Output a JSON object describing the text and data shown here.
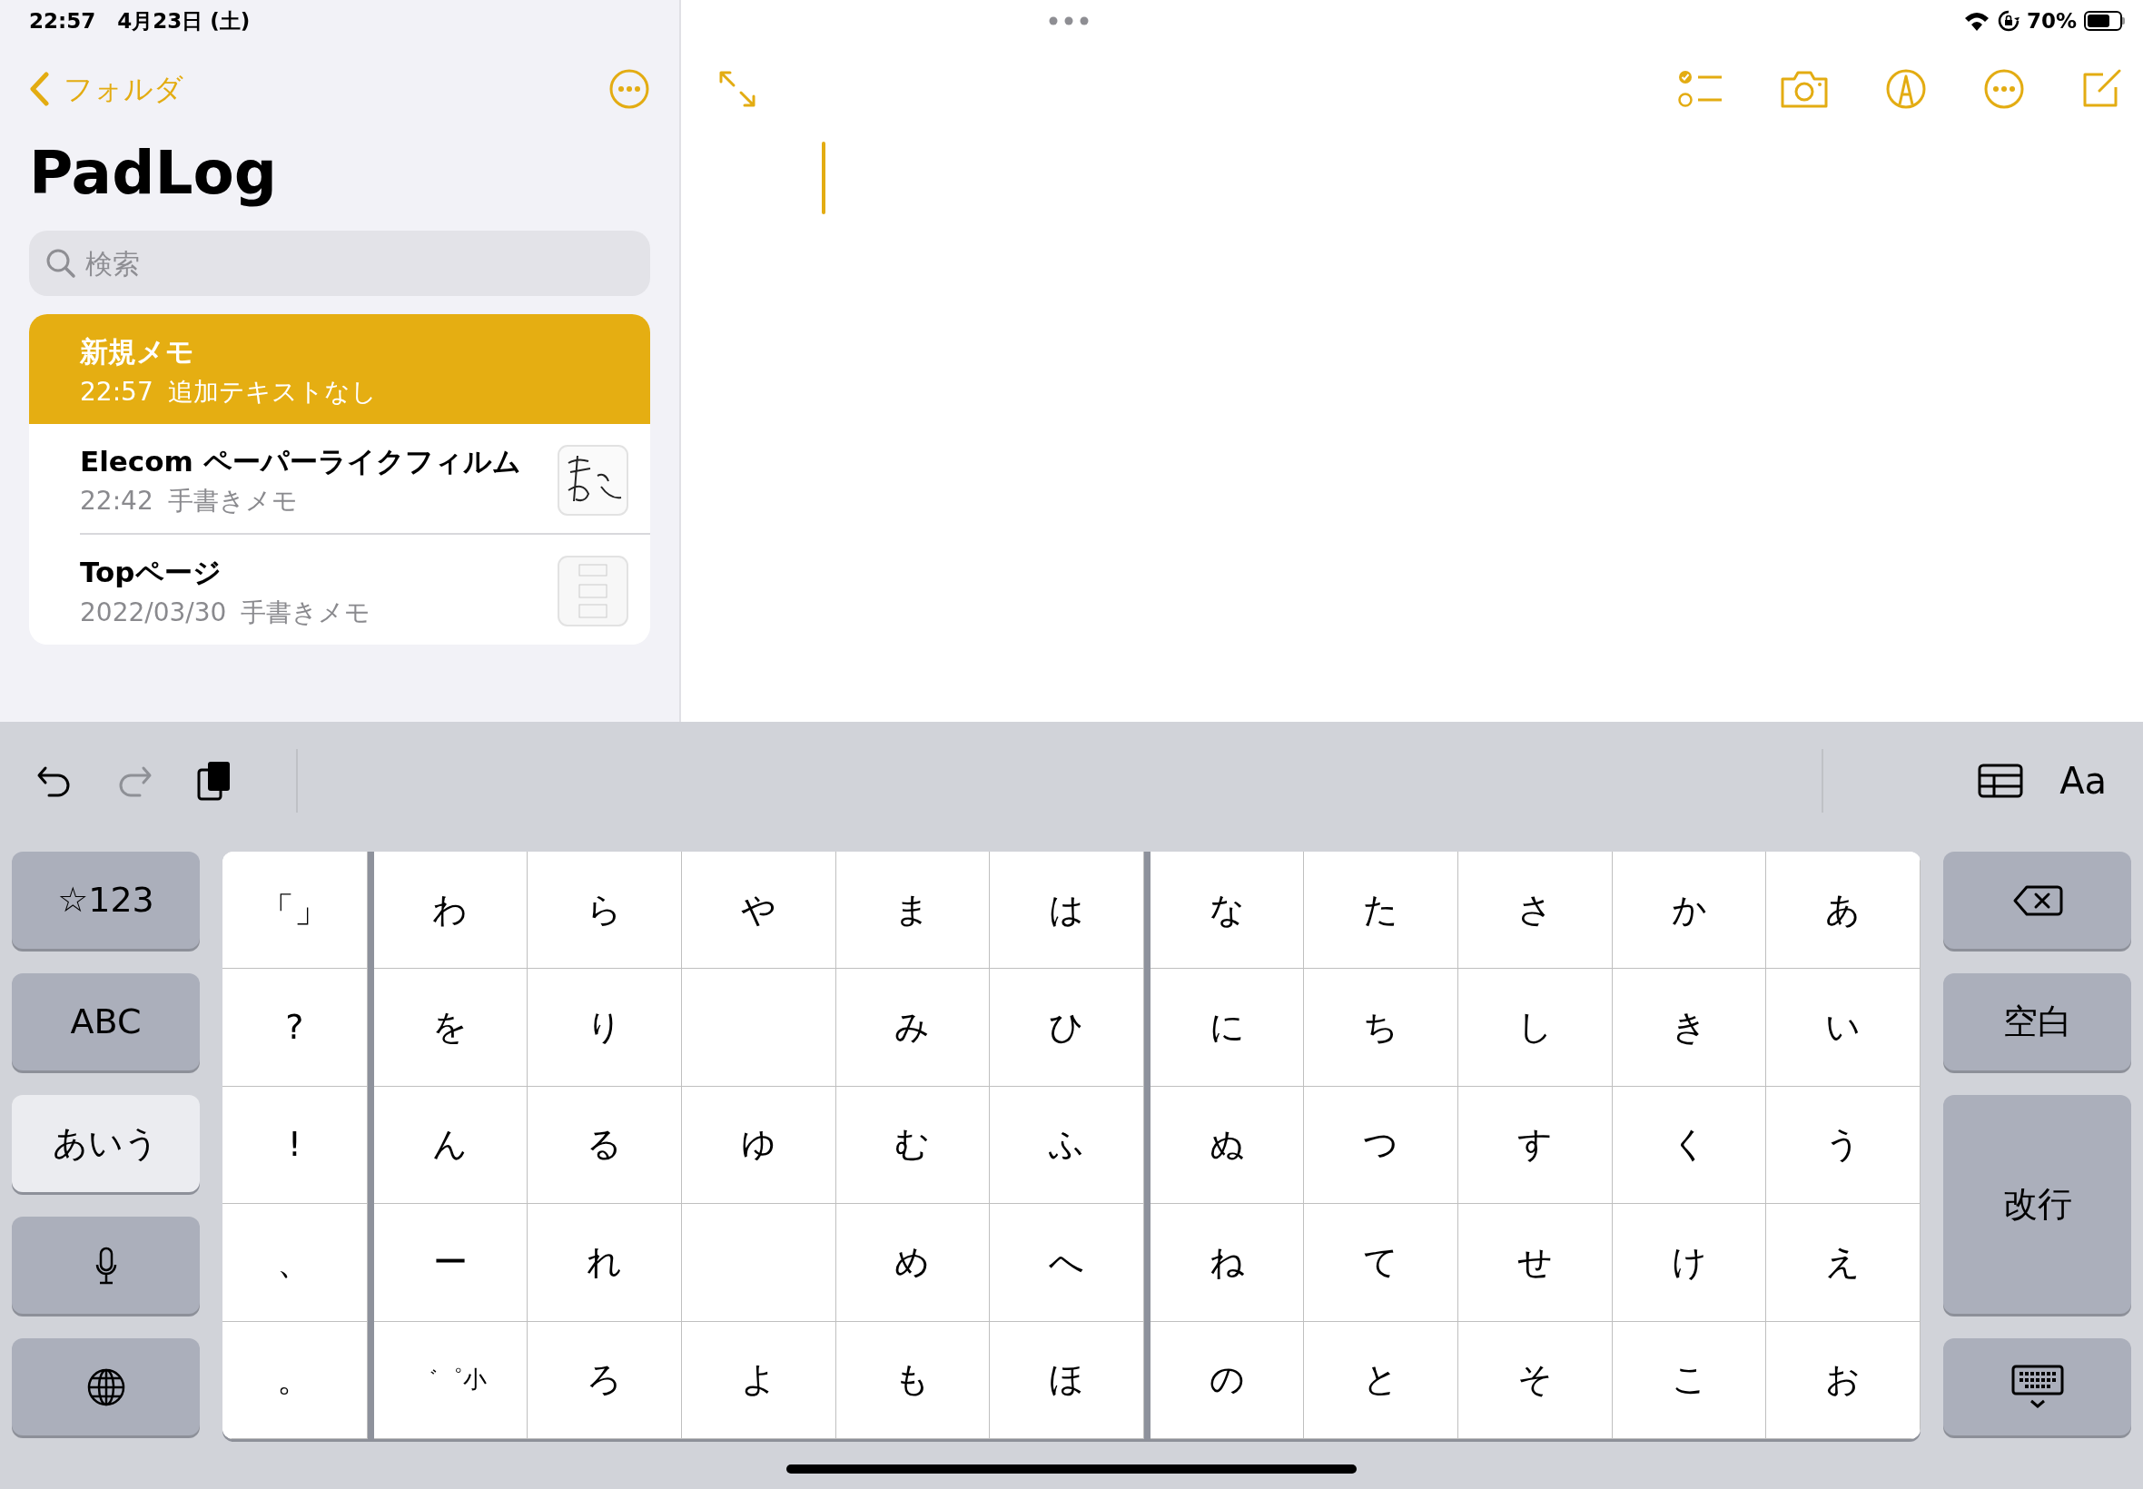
{
  "status_bar": {
    "time": "22:57",
    "date": "4月23日 (土)",
    "battery": "70%"
  },
  "sidebar": {
    "back_label": "フォルダ",
    "title": "PadLog",
    "search": {
      "placeholder": "検索"
    },
    "notes": [
      {
        "title": "新規メモ",
        "time": "22:57",
        "preview": "追加テキストなし",
        "selected": true
      },
      {
        "title": "Elecom ペーパーライクフィルム",
        "time": "22:42",
        "preview": "手書きメモ",
        "selected": false,
        "thumbnail": {
          "kind": "handwriting"
        }
      },
      {
        "title": "Topページ",
        "time": "2022/03/30",
        "preview": "手書きメモ",
        "selected": false,
        "thumbnail": {
          "kind": "page"
        }
      }
    ]
  },
  "keyboard": {
    "format_label": "Aa",
    "left_keys": [
      {
        "kind": "text",
        "label": "☆123",
        "selected": false
      },
      {
        "kind": "text",
        "label": "ABC",
        "selected": false
      },
      {
        "kind": "text",
        "label": "あいう",
        "selected": true
      },
      {
        "kind": "mic",
        "selected": false
      },
      {
        "kind": "globe",
        "selected": false
      }
    ],
    "key_groups": [
      {
        "rows": [
          [
            "「」"
          ],
          [
            "?"
          ],
          [
            "!"
          ],
          [
            "、"
          ],
          [
            "。"
          ]
        ]
      },
      {
        "rows": [
          [
            "わ",
            "ら",
            "や",
            "ま",
            "は"
          ],
          [
            "を",
            "り",
            null,
            "み",
            "ひ"
          ],
          [
            "ん",
            "る",
            "ゆ",
            "む",
            "ふ"
          ],
          [
            "ー",
            "れ",
            null,
            "め",
            "へ"
          ],
          [
            "゛゜小",
            "ろ",
            "よ",
            "も",
            "ほ"
          ]
        ]
      },
      {
        "rows": [
          [
            "な",
            "た",
            "さ",
            "か",
            "あ"
          ],
          [
            "に",
            "ち",
            "し",
            "き",
            "い"
          ],
          [
            "ぬ",
            "つ",
            "す",
            "く",
            "う"
          ],
          [
            "ね",
            "て",
            "せ",
            "け",
            "え"
          ],
          [
            "の",
            "と",
            "そ",
            "こ",
            "お"
          ]
        ]
      }
    ],
    "right_keys": [
      {
        "kind": "delete"
      },
      {
        "kind": "text",
        "label": "空白"
      },
      {
        "kind": "tall",
        "label": "改行"
      },
      {
        "kind": "dismiss"
      }
    ]
  }
}
